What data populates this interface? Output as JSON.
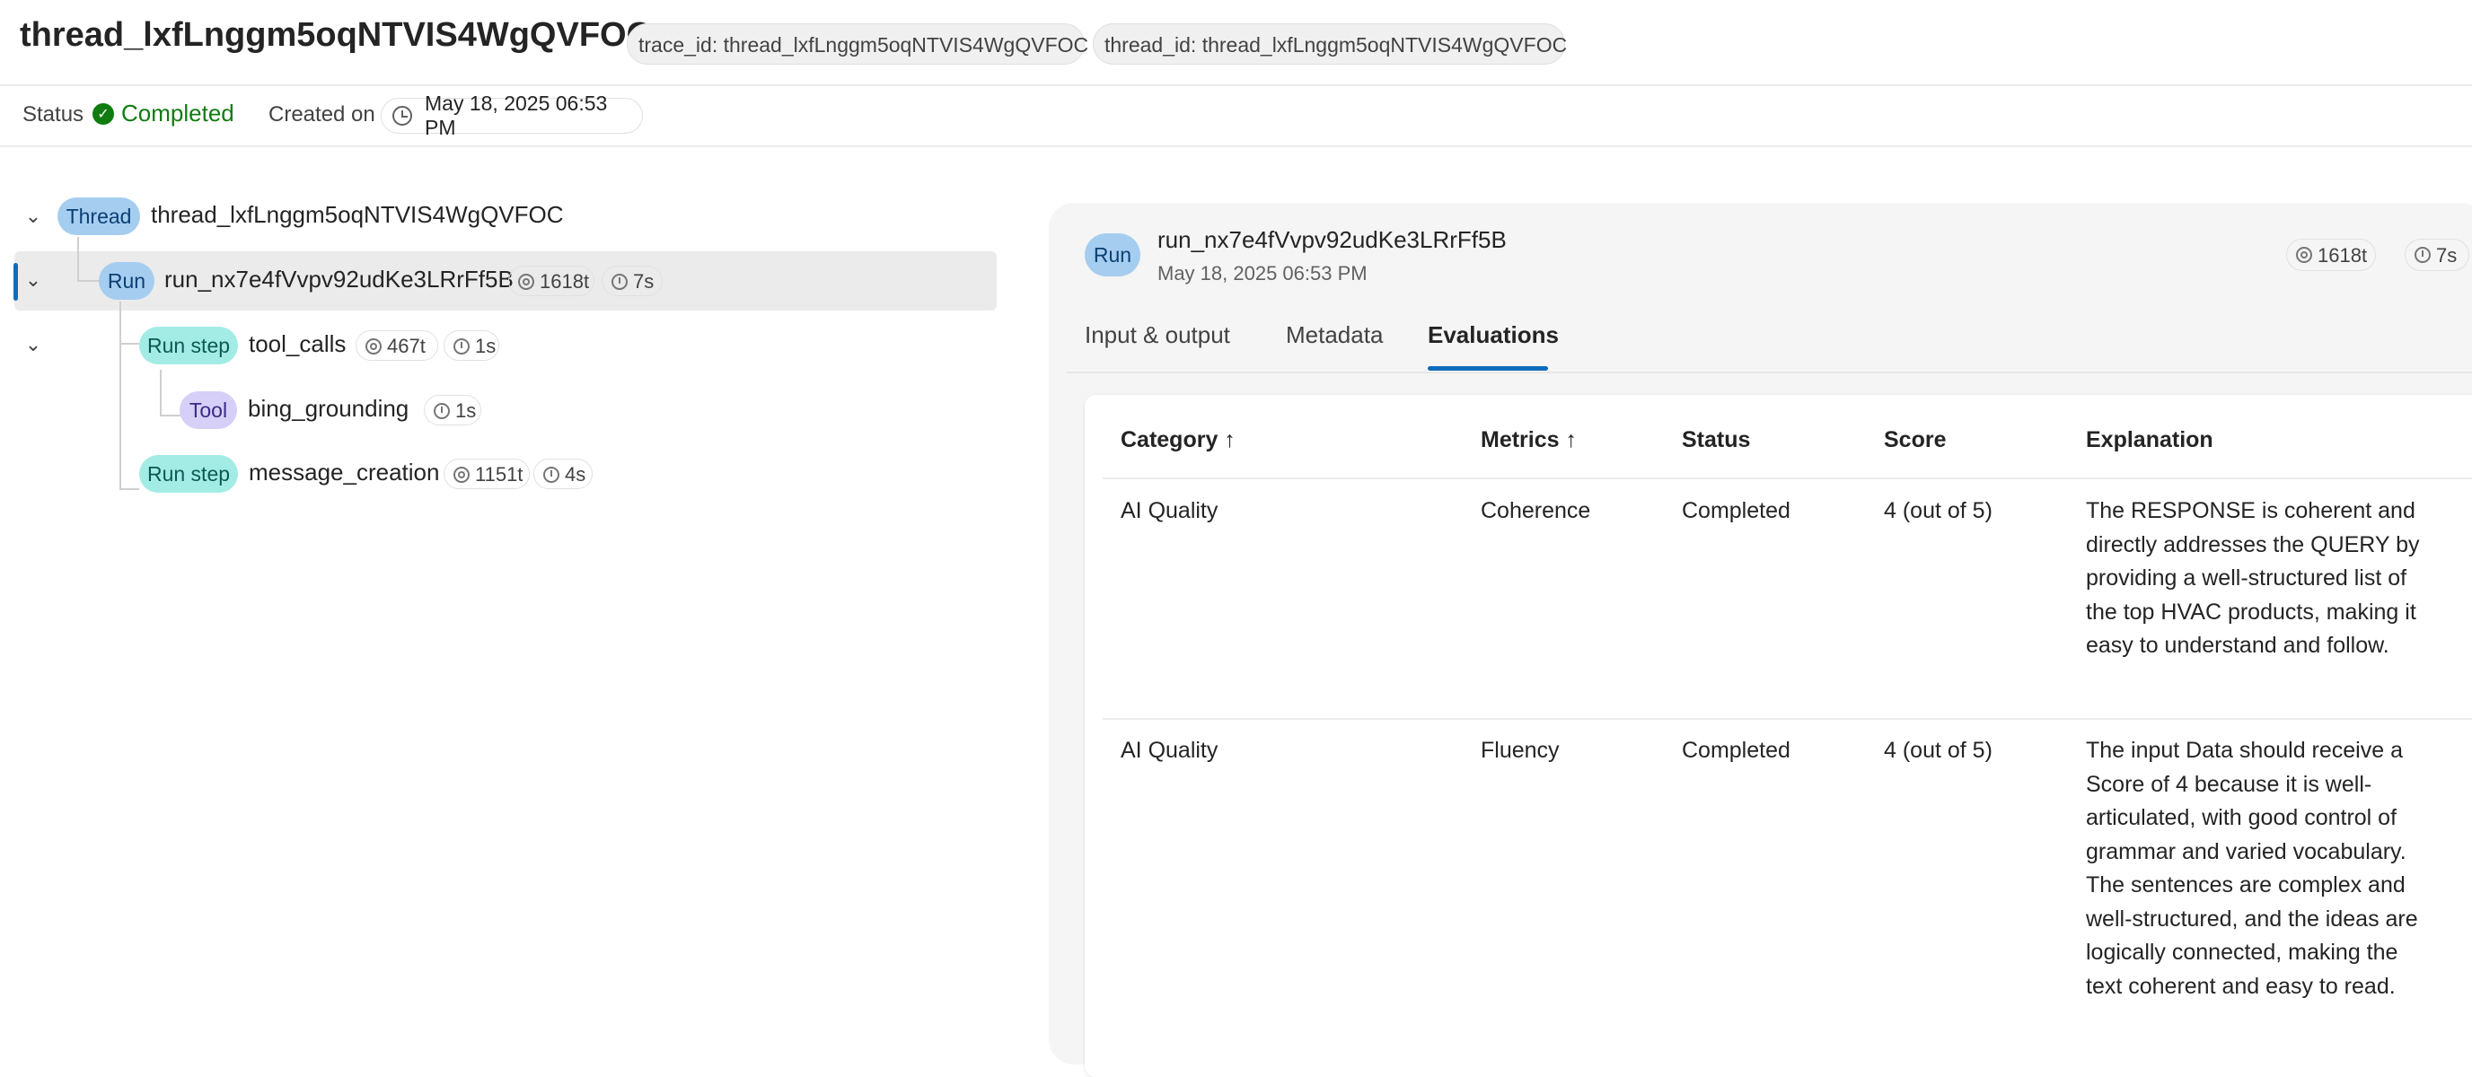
{
  "header": {
    "title": "thread_lxfLnggm5oqNTVIS4WgQVFOC",
    "trace_pill": "trace_id: thread_lxfLnggm5oqNTVIS4WgQVFOC",
    "thread_pill": "thread_id: thread_lxfLnggm5oqNTVIS4WgQVFOC"
  },
  "status_bar": {
    "status_label": "Status",
    "status_value": "Completed",
    "created_label": "Created on",
    "created_value": "May 18, 2025 06:53 PM"
  },
  "tree": {
    "thread": {
      "type": "Thread",
      "name": "thread_lxfLnggm5oqNTVIS4WgQVFOC"
    },
    "run": {
      "type": "Run",
      "name": "run_nx7e4fVvpv92udKe3LRrFf5B",
      "tokens": "1618t",
      "time": "7s"
    },
    "step1": {
      "type": "Run step",
      "name": "tool_calls",
      "tokens": "467t",
      "time": "1s"
    },
    "tool": {
      "type": "Tool",
      "name": "bing_grounding",
      "time": "1s"
    },
    "step2": {
      "type": "Run step",
      "name": "message_creation",
      "tokens": "1151t",
      "time": "4s"
    }
  },
  "panel": {
    "badge": "Run",
    "run_name": "run_nx7e4fVvpv92udKe3LRrFf5B",
    "date": "May 18, 2025 06:53 PM",
    "tokens": "1618t",
    "time": "7s",
    "tabs": [
      "Input & output",
      "Metadata",
      "Evaluations"
    ],
    "active_tab": "Evaluations"
  },
  "table": {
    "columns": [
      "Category",
      "Metrics",
      "Status",
      "Score",
      "Explanation"
    ],
    "sort_arrow": "↑",
    "rows": [
      {
        "category": "AI Quality",
        "metric": "Coherence",
        "status": "Completed",
        "score": "4 (out of 5)",
        "explanation": "The RESPONSE is coherent and directly addresses the QUERY by providing a well-structured list of the top HVAC products, making it easy to understand and follow."
      },
      {
        "category": "AI Quality",
        "metric": "Fluency",
        "status": "Completed",
        "score": "4 (out of 5)",
        "explanation": "The input Data should receive a Score of 4 because it is well-articulated, with good control of grammar and varied vocabulary. The sentences are complex and well-structured, and the ideas are logically connected, making the text coherent and easy to read."
      }
    ]
  },
  "colors": {
    "accent": "#0f6cbd",
    "success": "#107c10",
    "thread_badge": "#a5cdf0",
    "step_badge": "#a3ece6",
    "tool_badge": "#d6cff7"
  }
}
